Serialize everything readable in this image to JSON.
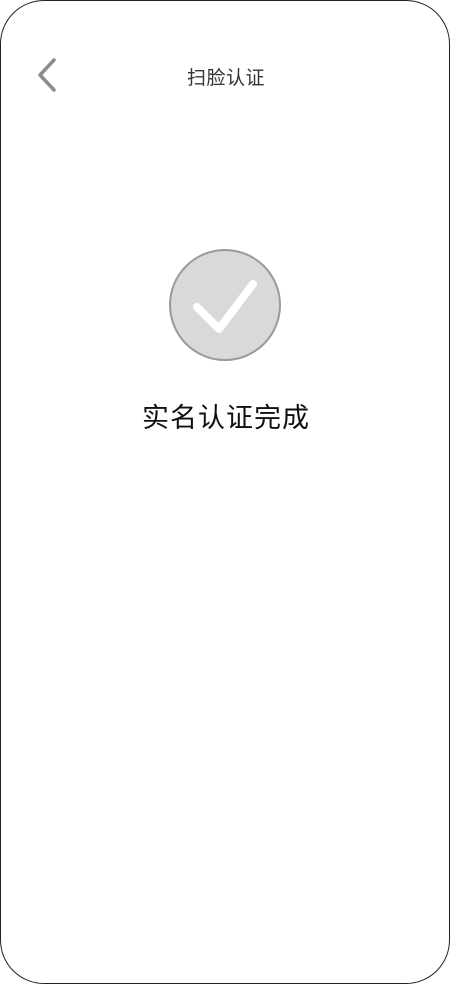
{
  "header": {
    "title": "扫脸认证",
    "back_icon": "chevron-left-icon"
  },
  "result": {
    "icon": "check-circle-icon",
    "message": "实名认证完成"
  },
  "colors": {
    "check_fill": "#d9d9d9",
    "check_stroke": "#9a9a9a",
    "check_mark": "#ffffff",
    "back_icon": "#8c8c8c"
  }
}
